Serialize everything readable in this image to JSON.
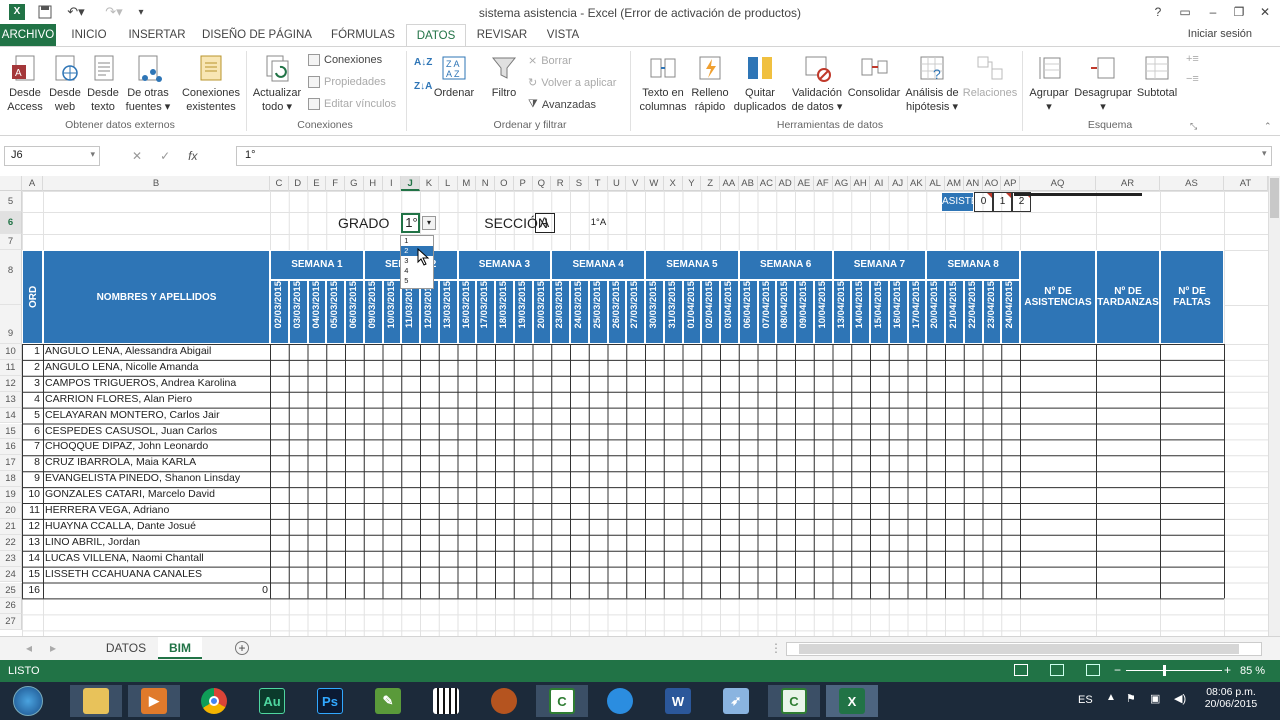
{
  "window": {
    "title": "sistema asistencia - Excel (Error de activación de productos)"
  },
  "tabs": [
    "ARCHIVO",
    "INICIO",
    "INSERTAR",
    "DISEÑO DE PÁGINA",
    "FÓRMULAS",
    "DATOS",
    "REVISAR",
    "VISTA"
  ],
  "signin": "Iniciar sesión",
  "ribbon": {
    "buttons": [
      {
        "l1": "Desde",
        "l2": "Access"
      },
      {
        "l1": "Desde",
        "l2": "web"
      },
      {
        "l1": "Desde",
        "l2": "texto"
      },
      {
        "l1": "De otras",
        "l2": "fuentes ▾"
      },
      {
        "l1": "Conexiones",
        "l2": "existentes"
      },
      {
        "l1": "Actualizar",
        "l2": "todo ▾"
      },
      {
        "l1": "Ordenar",
        "l2": ""
      },
      {
        "l1": "Filtro",
        "l2": ""
      },
      {
        "l1": "Texto en",
        "l2": "columnas"
      },
      {
        "l1": "Relleno",
        "l2": "rápido"
      },
      {
        "l1": "Quitar",
        "l2": "duplicados"
      },
      {
        "l1": "Validación",
        "l2": "de datos ▾"
      },
      {
        "l1": "Consolidar",
        "l2": ""
      },
      {
        "l1": "Análisis de",
        "l2": "hipótesis ▾"
      },
      {
        "l1": "Relaciones",
        "l2": ""
      },
      {
        "l1": "Agrupar",
        "l2": "▾"
      },
      {
        "l1": "Desagrupar",
        "l2": "▾"
      },
      {
        "l1": "Subtotal",
        "l2": ""
      }
    ],
    "small": [
      "Conexiones",
      "Propiedades",
      "Editar vínculos",
      "Borrar",
      "Volver a aplicar",
      "Avanzadas"
    ],
    "groups": [
      "Obtener datos externos",
      "Conexiones",
      "Ordenar y filtrar",
      "Herramientas de datos",
      "Esquema"
    ]
  },
  "formula": {
    "namebox": "J6",
    "value": "1°",
    "fx": "fx"
  },
  "columns": [
    "A",
    "B",
    "C",
    "D",
    "E",
    "F",
    "G",
    "H",
    "I",
    "J",
    "K",
    "L",
    "M",
    "N",
    "O",
    "P",
    "Q",
    "R",
    "S",
    "T",
    "U",
    "V",
    "W",
    "X",
    "Y",
    "Z",
    "AA",
    "AB",
    "AC",
    "AD",
    "AE",
    "AF",
    "AG",
    "AH",
    "AI",
    "AJ",
    "AK",
    "AL",
    "AM",
    "AN",
    "AO",
    "AP",
    "AQ",
    "AR",
    "AS",
    "AT"
  ],
  "rows": [
    "5",
    "6",
    "7",
    "8",
    "9",
    "10",
    "11",
    "12",
    "13",
    "14",
    "15",
    "16",
    "17",
    "18",
    "19",
    "20",
    "21",
    "22",
    "23",
    "24",
    "25",
    "26",
    "27"
  ],
  "sheet": {
    "grado_label": "GRADO",
    "grado_value": "1°",
    "seccion_label": "SECCIÓN",
    "seccion_value": "A",
    "combo": "1°A",
    "asistencia_label": "ASISTENCIA",
    "asistencia_codes": [
      "0",
      "1",
      "2"
    ],
    "dropdown_options": [
      "1",
      "2",
      "3",
      "4",
      "5"
    ],
    "ord_header": "ORD",
    "names_header": "NOMBRES Y APELLIDOS",
    "weeks": [
      "SEMANA 1",
      "SEMANA 2",
      "SEMANA 3",
      "SEMANA 4",
      "SEMANA 5",
      "SEMANA 6",
      "SEMANA 7",
      "SEMANA 8"
    ],
    "dates": [
      "02/03/2015",
      "03/03/2015",
      "04/03/2015",
      "05/03/2015",
      "06/03/2015",
      "09/03/2015",
      "10/03/2015",
      "11/03/2015",
      "12/03/2015",
      "13/03/2015",
      "16/03/2015",
      "17/03/2015",
      "18/03/2015",
      "19/03/2015",
      "20/03/2015",
      "23/03/2015",
      "24/03/2015",
      "25/03/2015",
      "26/03/2015",
      "27/03/2015",
      "30/03/2015",
      "31/03/2015",
      "01/04/2015",
      "02/04/2015",
      "03/04/2015",
      "06/04/2015",
      "07/04/2015",
      "08/04/2015",
      "09/04/2015",
      "10/04/2015",
      "13/04/2015",
      "14/04/2015",
      "15/04/2015",
      "16/04/2015",
      "17/04/2015",
      "20/04/2015",
      "21/04/2015",
      "22/04/2015",
      "23/04/2015",
      "24/04/2015"
    ],
    "totals": [
      "Nº DE ASISTENCIAS",
      "Nº DE TARDANZAS",
      "Nº DE FALTAS"
    ],
    "students": [
      {
        "n": "1",
        "name": "ANGULO LENA, Alessandra Abigail"
      },
      {
        "n": "2",
        "name": "ANGULO LENA, Nicolle Amanda"
      },
      {
        "n": "3",
        "name": "CAMPOS TRIGUEROS, Andrea Karolina"
      },
      {
        "n": "4",
        "name": "CARRION FLORES, Alan Piero"
      },
      {
        "n": "5",
        "name": "CELAYARAN MONTERO, Carlos Jair"
      },
      {
        "n": "6",
        "name": "CESPEDES CASUSOL, Juan Carlos"
      },
      {
        "n": "7",
        "name": "CHOQQUE DIPAZ, John Leonardo"
      },
      {
        "n": "8",
        "name": "CRUZ IBARROLA, Maia KARLA"
      },
      {
        "n": "9",
        "name": "EVANGELISTA PINEDO, Shanon Linsday"
      },
      {
        "n": "10",
        "name": "GONZALES CATARI, Marcelo David"
      },
      {
        "n": "11",
        "name": "HERRERA VEGA, Adriano"
      },
      {
        "n": "12",
        "name": "HUAYNA CCALLA, Dante Josué"
      },
      {
        "n": "13",
        "name": "LINO ABRIL, Jordan"
      },
      {
        "n": "14",
        "name": "LUCAS VILLENA, Naomi Chantall"
      },
      {
        "n": "15",
        "name": "LISSETH CCAHUANA CANALES"
      },
      {
        "n": "16",
        "name": "0"
      }
    ]
  },
  "sheettabs": [
    "DATOS",
    "BIM"
  ],
  "status": {
    "left": "LISTO",
    "zoom": "85 %"
  },
  "taskbar": {
    "lang": "ES",
    "time": "08:06 p.m.",
    "date": "20/06/2015"
  },
  "colors": {
    "excel_green": "#217346",
    "header_blue": "#2e75b6",
    "taskbar": "#1c2a3a"
  }
}
